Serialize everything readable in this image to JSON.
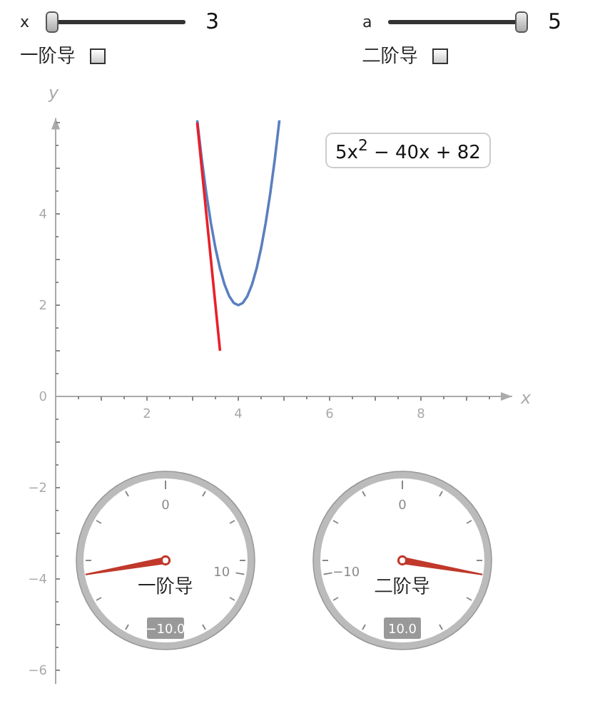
{
  "controls": [
    {
      "label": "x",
      "level": 0,
      "reading": "3",
      "checkbox_label": "一阶导",
      "checked": false
    },
    {
      "label": "a",
      "level": 1,
      "reading": "5",
      "checkbox_label": "二阶导",
      "checked": false
    }
  ],
  "plot": {
    "formula": "5x$^{2}$ − 40x + 82",
    "chart_data": {
      "type": "line",
      "xlabel": "x",
      "ylabel": "y",
      "xlim": [
        0,
        10
      ],
      "ylim": [
        -6.3,
        6.1
      ],
      "xticks": [
        2,
        4,
        6,
        8
      ],
      "yticks": [
        -6,
        -4,
        -2,
        0,
        2,
        4
      ],
      "x": [
        3.1,
        3.2,
        3.3,
        3.4,
        3.5,
        3.6,
        3.7,
        3.8,
        3.9,
        4.0,
        4.1,
        4.2,
        4.3,
        4.4,
        4.5,
        4.6,
        4.7,
        4.8,
        4.9
      ],
      "series": [
        {
          "color": "#5b7fbf",
          "values": [
            6.05,
            5.2,
            4.45,
            3.8,
            3.25,
            2.8,
            2.45,
            2.2,
            2.05,
            2,
            2.05,
            2.2,
            2.45,
            2.8,
            3.25,
            3.8,
            4.45,
            5.2,
            6.05
          ]
        },
        {
          "color": "#e8202a",
          "values": [
            6,
            5,
            4,
            3,
            2,
            1,
            null,
            null,
            null,
            null,
            null,
            null,
            null,
            null,
            null,
            null,
            null,
            null,
            null
          ]
        }
      ]
    }
  },
  "gauges": [
    {
      "label": "一阶导",
      "tick_labels": [
        {
          "kind": "mid",
          "text": "0"
        },
        {
          "kind": "max",
          "text": "10"
        }
      ],
      "reading": "−10.0"
    },
    {
      "label": "二阶导",
      "tick_labels": [
        {
          "kind": "min",
          "text": "−10"
        },
        {
          "kind": "mid",
          "text": "0"
        }
      ],
      "reading": "10.0"
    }
  ]
}
